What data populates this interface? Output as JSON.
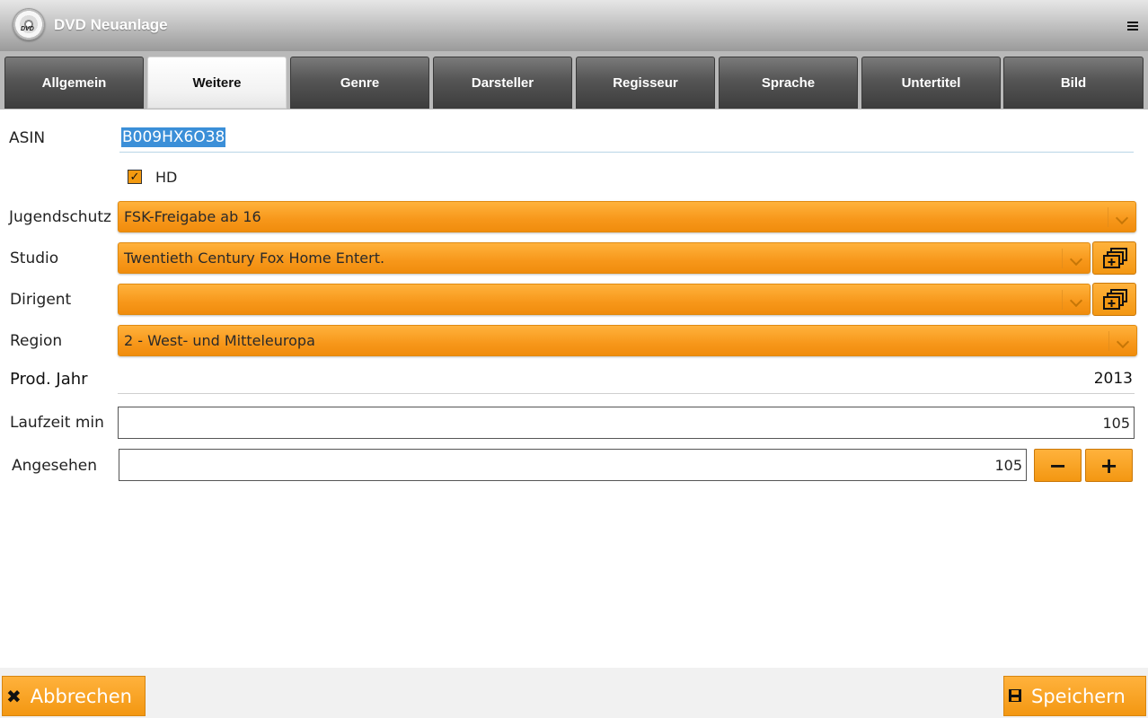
{
  "window": {
    "title": "DVD Neuanlage",
    "logo_text": "DVD"
  },
  "tabs": [
    {
      "label": "Allgemein",
      "active": false
    },
    {
      "label": "Weitere",
      "active": true
    },
    {
      "label": "Genre",
      "active": false
    },
    {
      "label": "Darsteller",
      "active": false
    },
    {
      "label": "Regisseur",
      "active": false
    },
    {
      "label": "Sprache",
      "active": false
    },
    {
      "label": "Untertitel",
      "active": false
    },
    {
      "label": "Bild",
      "active": false
    }
  ],
  "form": {
    "asin": {
      "label": "ASIN",
      "value": "B009HX6O38"
    },
    "hd": {
      "label": "HD",
      "checked": true
    },
    "jugendschutz": {
      "label": "Jugendschutz",
      "value": "FSK-Freigabe ab 16"
    },
    "studio": {
      "label": "Studio",
      "value": "Twentieth Century Fox Home Entert."
    },
    "dirigent": {
      "label": "Dirigent",
      "value": ""
    },
    "region": {
      "label": "Region",
      "value": "2 - West- und Mitteleuropa"
    },
    "prod_jahr": {
      "label": "Prod. Jahr",
      "value": "2013"
    },
    "laufzeit": {
      "label": "Laufzeit min",
      "value": "105"
    },
    "angesehen": {
      "label": "Angesehen",
      "value": "105",
      "minus": "−",
      "plus": "+"
    }
  },
  "footer": {
    "cancel_label": "Abbrechen",
    "save_label": "Speichern"
  },
  "colors": {
    "accent": "#f7971a",
    "tab_dark": "#4a4a4a",
    "selection": "#3b8fd8"
  }
}
